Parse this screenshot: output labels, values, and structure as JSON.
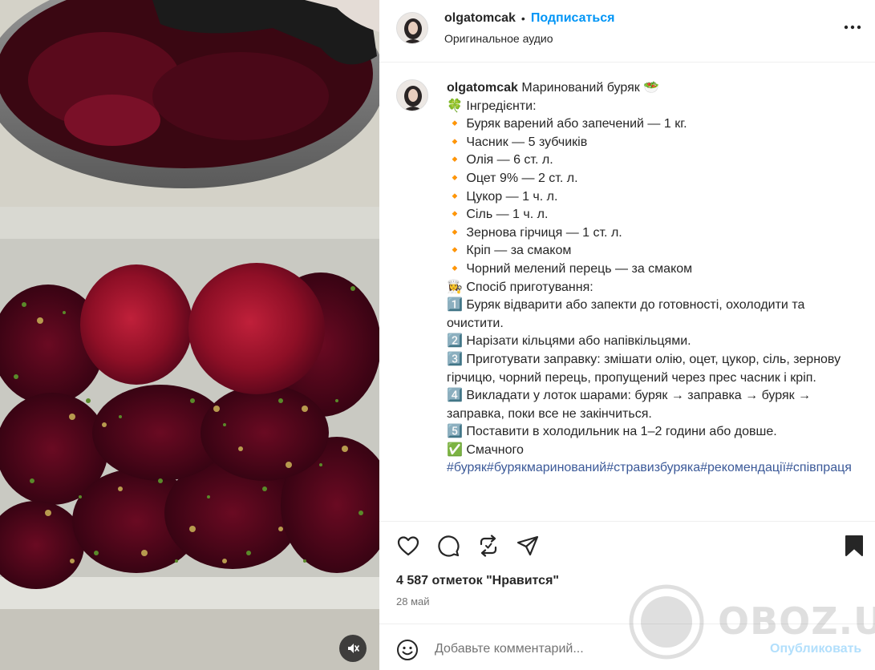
{
  "post_header": {
    "username": "olgatomcak",
    "separator": "•",
    "follow_label": "Подписаться",
    "audio_label": "Оригинальное аудио"
  },
  "caption": {
    "username": "olgatomcak",
    "title": " Маринований буряк 🥗",
    "body": "🍀 Інгредієнти:\n🔸 Буряк варений або запечений — 1 кг.\n🔸 Часник — 5 зубчиків\n🔸 Олія — 6 ст. л.\n🔸 Оцет 9% — 2 ст. л.\n🔸 Цукор — 1 ч. л.\n🔸 Сіль — 1 ч. л.\n🔸 Зернова гірчиця — 1 ст. л.\n🔸 Кріп — за смаком\n🔸 Чорний мелений перець — за смаком\n👩‍🍳 Спосіб приготування:\n1️⃣ Буряк відварити або запекти до готовності, охолодити та очистити.\n2️⃣ Нарізати кільцями або напівкільцями.\n3️⃣ Приготувати заправку: змішати олію, оцет, цукор, сіль, зернову гірчицю, чорний перець, пропущений через прес часник і кріп.\n4️⃣ Викладати у лоток шарами: буряк → заправка → буряк → заправка, поки все не закінчиться.\n5️⃣ Поставити в холодильник на 1–2 години або довше.\n✅ Смачного\n",
    "hashtags": "#буряк#бурякмаринований#стравизбуряка#рекомендації#співпраця"
  },
  "engagement": {
    "likes_text": "4 587 отметок \"Нравится\"",
    "date": "28 май"
  },
  "comment": {
    "placeholder": "Добавьте комментарий...",
    "publish_label": "Опубликовать"
  },
  "icons": {
    "like": "heart-icon",
    "comment": "comment-bubble-icon",
    "repost": "repost-icon",
    "share": "send-icon",
    "save": "bookmark-icon",
    "more": "more-options-icon",
    "mute": "speaker-muted-icon",
    "emoji": "emoji-icon"
  },
  "watermark": {
    "text": "OBOZ.UA"
  },
  "colors": {
    "accent": "#0095f6",
    "hashtag": "#3b5998",
    "publish_disabled": "#b2dffc"
  }
}
